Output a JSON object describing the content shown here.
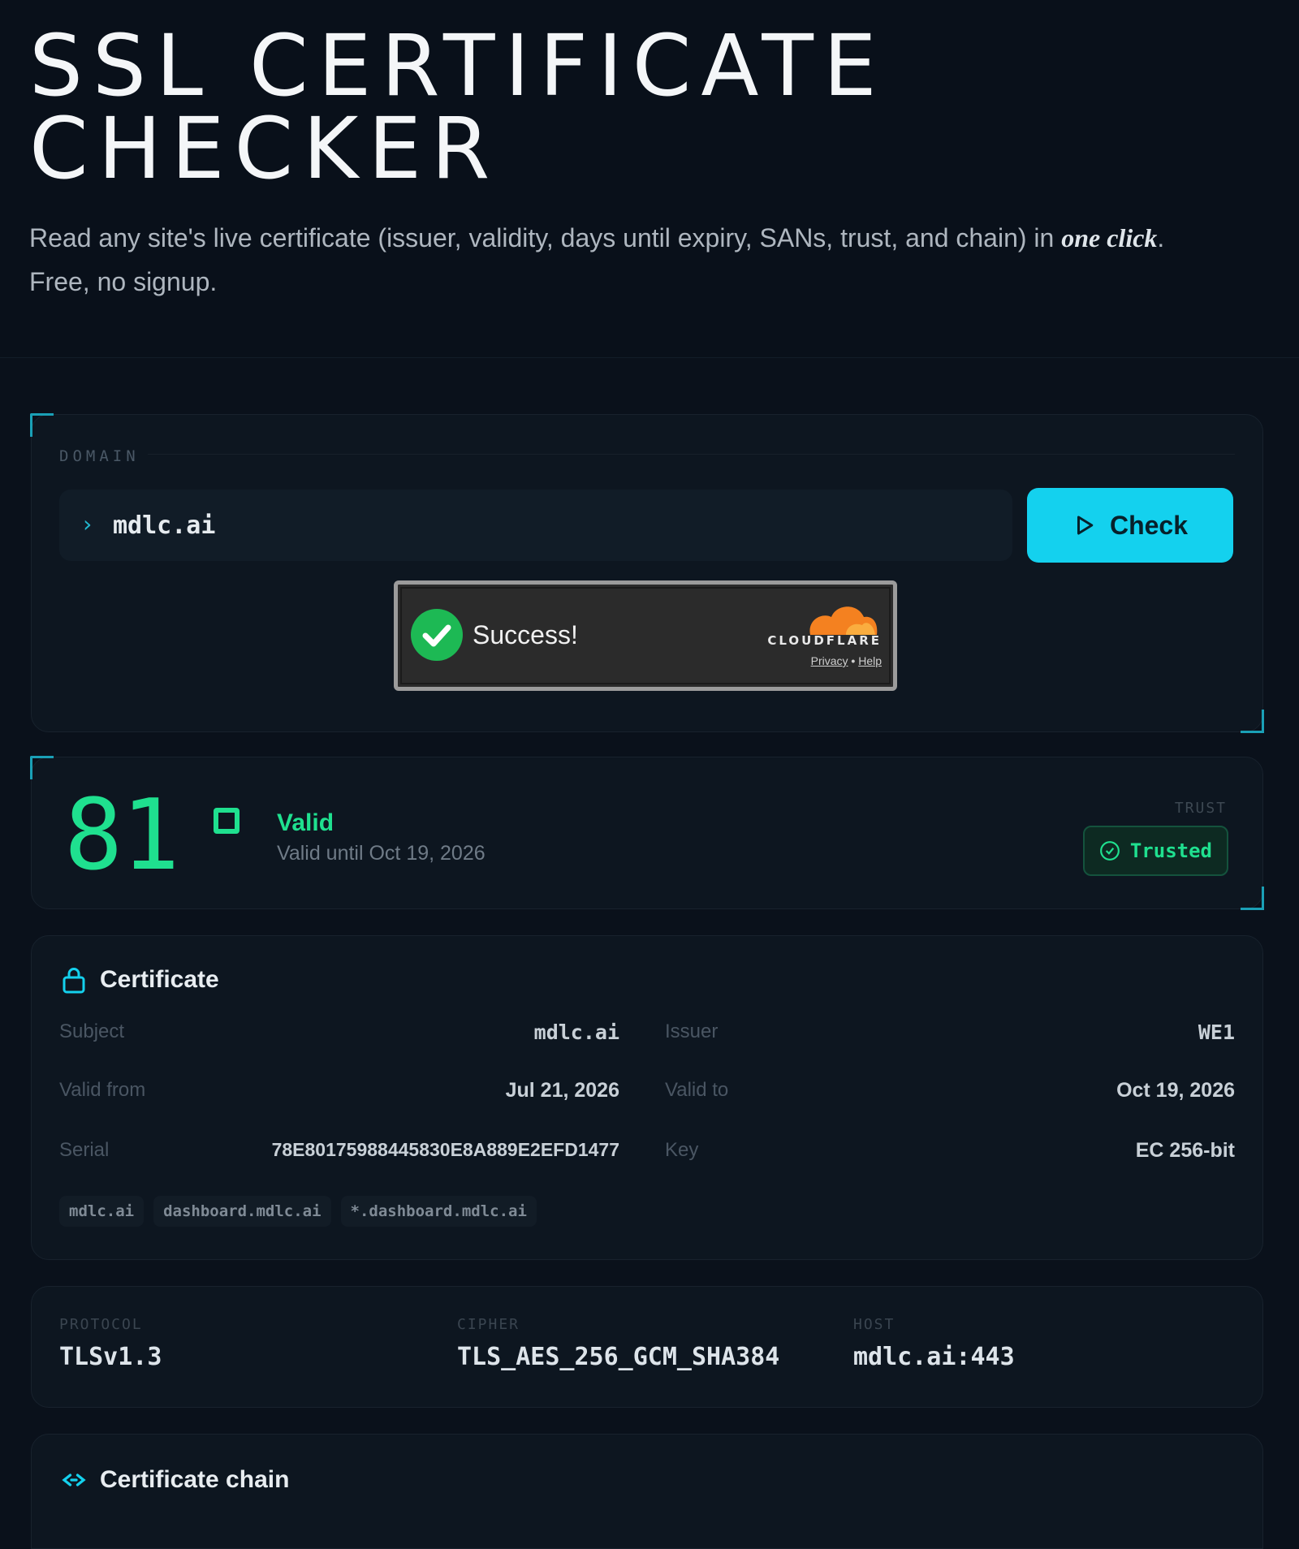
{
  "header": {
    "title_line1": "SSL CERTIFICATE",
    "title_line2": "CHECKER",
    "subtitle_before": "Read any site's live certificate (issuer, validity, days until expiry, SANs, trust, and chain) in ",
    "subtitle_emphasis": "one click",
    "subtitle_after": ". Free, no signup."
  },
  "domain_form": {
    "label": "DOMAIN",
    "prompt_symbol": "›",
    "value": "mdlc.ai",
    "check_label": "Check"
  },
  "turnstile": {
    "status": "Success!",
    "brand": "CLOUDFLARE",
    "privacy_link": "Privacy",
    "separator": "•",
    "help_link": "Help"
  },
  "status": {
    "days": "81",
    "state": "Valid",
    "valid_until": "Valid until Oct 19, 2026",
    "trust_label": "TRUST",
    "trust_value": "Trusted"
  },
  "certificate": {
    "title": "Certificate",
    "subject_label": "Subject",
    "subject": "mdlc.ai",
    "issuer_label": "Issuer",
    "issuer": "WE1",
    "valid_from_label": "Valid from",
    "valid_from": "Jul 21, 2026",
    "valid_to_label": "Valid to",
    "valid_to": "Oct 19, 2026",
    "serial_label": "Serial",
    "serial": "78E8017598844583​0E8A889E2EFD1477",
    "key_label": "Key",
    "key": "EC 256-bit",
    "sans": [
      "mdlc.ai",
      "dashboard.mdlc.ai",
      "*.dashboard.mdlc.ai"
    ]
  },
  "connection": {
    "protocol_label": "PROTOCOL",
    "protocol": "TLSv1.3",
    "cipher_label": "CIPHER",
    "cipher": "TLS_AES_256_GCM_SHA384",
    "host_label": "HOST",
    "host": "mdlc.ai:443"
  },
  "chain": {
    "title": "Certificate chain"
  },
  "colors": {
    "accent_cyan": "#14d1ee",
    "valid_green": "#1fe08f",
    "background": "#0a111b",
    "card": "#0d1620"
  },
  "icons": {
    "lock": "lock-icon",
    "chain": "link-icon",
    "play": "play-icon",
    "trusted": "check-circle-icon"
  }
}
